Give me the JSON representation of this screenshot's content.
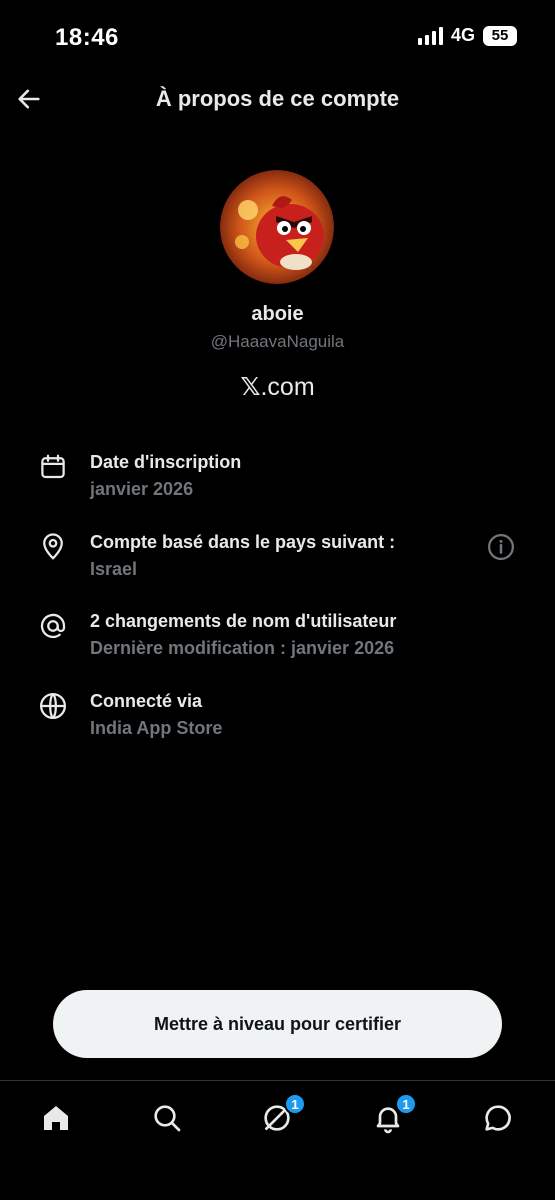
{
  "status_bar": {
    "time": "18:46",
    "network": "4G",
    "battery": "55"
  },
  "header": {
    "title": "À propos de ce compte",
    "back_icon": "arrow-left-icon"
  },
  "profile": {
    "display_name": "aboie",
    "handle": "@HaaavaNaguila",
    "domain_symbol": "𝕏",
    "domain_text": ".com"
  },
  "info": [
    {
      "icon": "calendar-icon",
      "title": "Date d'inscription",
      "subtitle": "janvier 2026"
    },
    {
      "icon": "location-pin-icon",
      "title": "Compte basé dans le pays suivant :",
      "subtitle": "Israel",
      "extra_icon": "info-icon"
    },
    {
      "icon": "at-sign-icon",
      "title": "2 changements de nom d'utilisateur",
      "subtitle": "Dernière modification : janvier 2026"
    },
    {
      "icon": "globe-icon",
      "title": "Connecté via",
      "subtitle": "India App Store"
    }
  ],
  "cta": {
    "label": "Mettre à niveau pour certifier"
  },
  "tabs": [
    {
      "icon": "home-icon",
      "badge": ""
    },
    {
      "icon": "search-icon",
      "badge": ""
    },
    {
      "icon": "grok-icon",
      "badge": "1"
    },
    {
      "icon": "bell-icon",
      "badge": "1"
    },
    {
      "icon": "messages-icon",
      "badge": ""
    }
  ],
  "colors": {
    "background": "#000000",
    "text": "#e7e9ea",
    "muted": "#71767b",
    "accent": "#1d9bf0",
    "button_bg": "#eff3f4"
  }
}
